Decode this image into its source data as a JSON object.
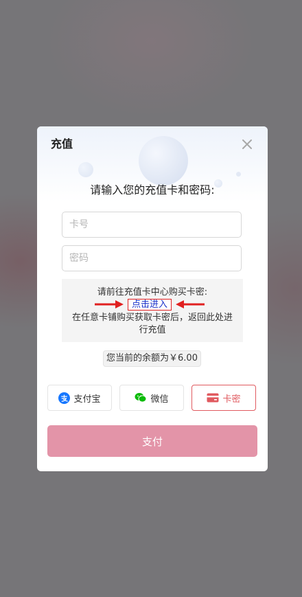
{
  "dialog": {
    "title": "充值",
    "prompt": "请输入您的充值卡和密码:",
    "card_number": {
      "placeholder": "卡号",
      "value": ""
    },
    "card_password": {
      "placeholder": "密码",
      "value": ""
    },
    "info": {
      "line1": "请前往充值卡中心购买卡密:",
      "link_label": "点击进入",
      "line3": "在任意卡铺购买获取卡密后，返回此处进行充值"
    },
    "balance_text": "您当前的余额为￥6.00",
    "payment_methods": [
      {
        "label": "支付宝",
        "icon": "alipay-icon",
        "selected": false
      },
      {
        "label": "微信",
        "icon": "wechat-icon",
        "selected": false
      },
      {
        "label": "卡密",
        "icon": "card-icon",
        "selected": true
      }
    ],
    "pay_button_label": "支付"
  },
  "colors": {
    "accent": "#e05a5f",
    "pay_button": "#e394a8",
    "link": "#1a31c9",
    "annotation_red": "#e02020",
    "alipay": "#1677ff",
    "wechat": "#09bb07"
  }
}
